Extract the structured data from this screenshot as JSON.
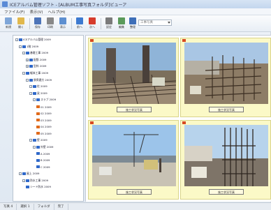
{
  "window": {
    "title": "ICEアルバム管理ソフト - [ALBUM工事写真フォルダ]ビューア"
  },
  "menu": [
    "ファイル(F)",
    "表示(V)",
    "ヘルプ(H)"
  ],
  "toolbar": {
    "buttons": [
      {
        "label": "新規",
        "icon": "new-icon",
        "color": "#7fa6d8"
      },
      {
        "label": "開く",
        "icon": "open-icon",
        "color": "#e1b84c"
      },
      {
        "label": "保存",
        "icon": "save-icon",
        "color": "#4d74b8"
      },
      {
        "label": "印刷",
        "icon": "print-icon",
        "color": "#888888"
      },
      {
        "label": "表示",
        "icon": "view-icon",
        "color": "#5d8fd0"
      },
      {
        "label": "前へ",
        "icon": "prev-icon",
        "color": "#3d7ad0"
      },
      {
        "label": "次へ",
        "icon": "next-icon",
        "color": "#d63c2c"
      },
      {
        "label": "設定",
        "icon": "settings-icon",
        "color": "#7a7a7a"
      },
      {
        "label": "編集",
        "icon": "edit-icon",
        "color": "#5a9a5a"
      },
      {
        "label": "整理",
        "icon": "sort-icon",
        "color": "#3e6fb8"
      }
    ],
    "combo_value": "工事写真"
  },
  "tree": {
    "nodes": [
      {
        "label": "ICEアルバム管理 2009",
        "level": 0,
        "exp": "-",
        "orange": false
      },
      {
        "label": "1階 2009",
        "level": 1,
        "exp": "-",
        "orange": false
      },
      {
        "label": "基礎工事 2009",
        "level": 2,
        "exp": "-",
        "orange": false
      },
      {
        "label": "配筋 2009",
        "level": 3,
        "exp": "+",
        "orange": false
      },
      {
        "label": "型枠 2009",
        "level": 3,
        "exp": "+",
        "orange": false
      },
      {
        "label": "躯体工事 2009",
        "level": 2,
        "exp": "-",
        "orange": false
      },
      {
        "label": "鉄骨建方 2009",
        "level": 3,
        "exp": "-",
        "orange": false
      },
      {
        "label": "柱 2009",
        "level": 4,
        "exp": "-",
        "orange": false
      },
      {
        "label": "梁 2009",
        "level": 4,
        "exp": "-",
        "orange": false
      },
      {
        "label": "スラブ 2009",
        "level": 5,
        "exp": "-",
        "orange": false
      },
      {
        "label": "01 2009",
        "level": 6,
        "exp": "",
        "orange": true
      },
      {
        "label": "02 2009",
        "level": 6,
        "exp": "",
        "orange": true
      },
      {
        "label": "03 2009",
        "level": 6,
        "exp": "",
        "orange": true
      },
      {
        "label": "04 2009",
        "level": 6,
        "exp": "",
        "orange": true
      },
      {
        "label": "05 2009",
        "level": 6,
        "exp": "",
        "orange": true
      },
      {
        "label": "壁 2009",
        "level": 4,
        "exp": "-",
        "orange": false
      },
      {
        "label": "外壁 2009",
        "level": 5,
        "exp": "-",
        "orange": false
      },
      {
        "label": "A 2009",
        "level": 6,
        "exp": "",
        "orange": false
      },
      {
        "label": "B 2009",
        "level": 6,
        "exp": "",
        "orange": false
      },
      {
        "label": "C 2009",
        "level": 6,
        "exp": "",
        "orange": false
      },
      {
        "label": "屋上 2009",
        "level": 1,
        "exp": "-",
        "orange": false
      },
      {
        "label": "防水工事 2009",
        "level": 2,
        "exp": "-",
        "orange": false
      },
      {
        "label": "シート防水 2009",
        "level": 3,
        "exp": "",
        "orange": false
      }
    ]
  },
  "thumbs": [
    {
      "caption": "施工状況写真"
    },
    {
      "caption": "施工状況写真"
    },
    {
      "caption": "施工状況写真"
    },
    {
      "caption": "施工状況写真"
    }
  ],
  "status": [
    "写真 4",
    "選択 1",
    "フォルダ",
    "完了"
  ]
}
